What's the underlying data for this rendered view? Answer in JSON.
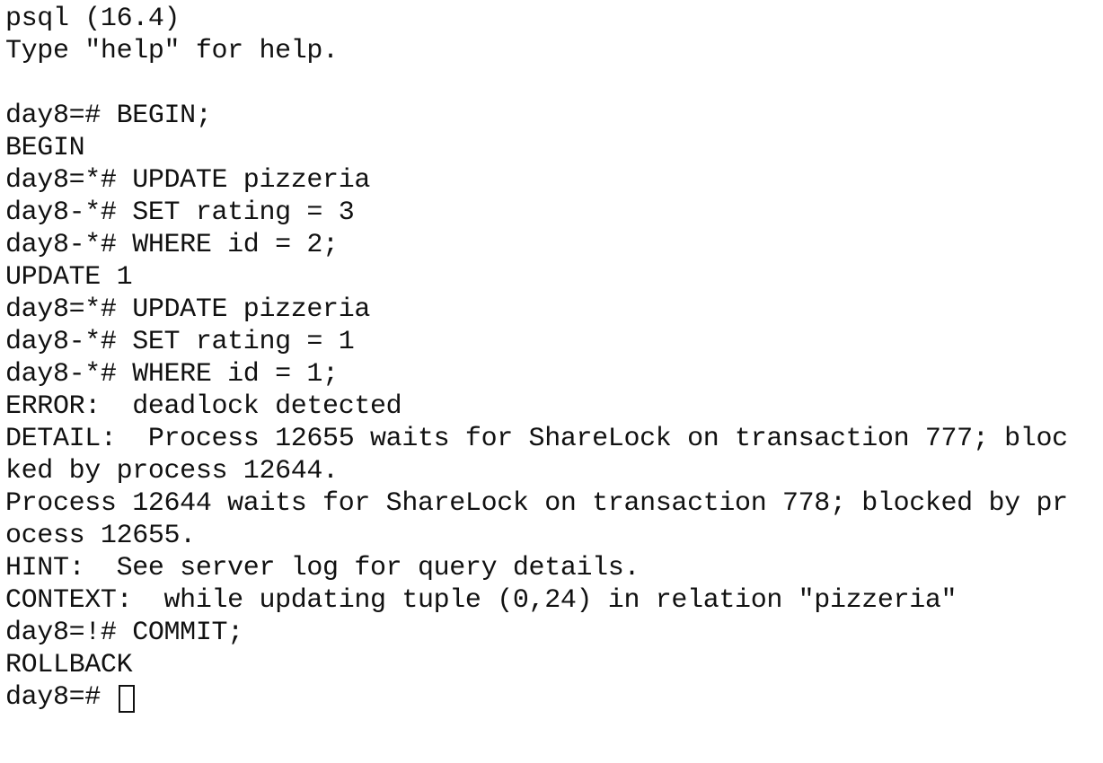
{
  "terminal": {
    "lines": [
      "psql (16.4)",
      "Type \"help\" for help.",
      "",
      "day8=# BEGIN;",
      "BEGIN",
      "day8=*# UPDATE pizzeria",
      "day8-*# SET rating = 3",
      "day8-*# WHERE id = 2;",
      "UPDATE 1",
      "day8=*# UPDATE pizzeria",
      "day8-*# SET rating = 1",
      "day8-*# WHERE id = 1;",
      "ERROR:  deadlock detected",
      "DETAIL:  Process 12655 waits for ShareLock on transaction 777; bloc",
      "ked by process 12644.",
      "Process 12644 waits for ShareLock on transaction 778; blocked by pr",
      "ocess 12655.",
      "HINT:  See server log for query details.",
      "CONTEXT:  while updating tuple (0,24) in relation \"pizzeria\"",
      "day8=!# COMMIT;",
      "ROLLBACK"
    ],
    "prompt": "day8=# "
  }
}
